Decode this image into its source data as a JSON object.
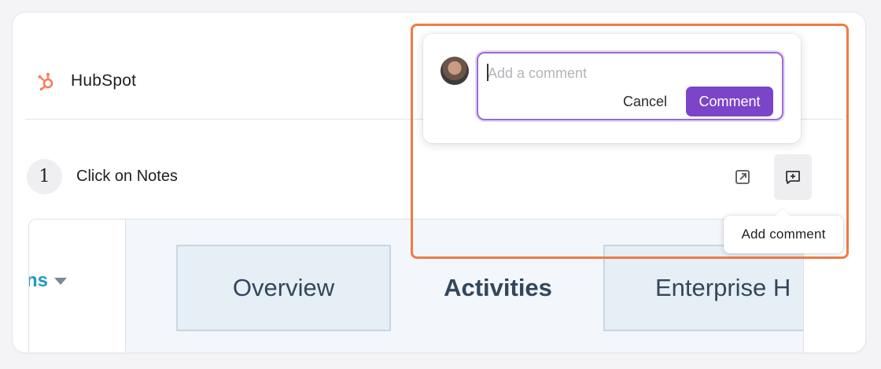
{
  "brand": {
    "name": "HubSpot",
    "logo_icon": "hubspot-sprocket-icon",
    "logo_color": "#ff7a59"
  },
  "step": {
    "number": "1",
    "text": "Click on Notes"
  },
  "actions": {
    "open_icon": "open-external-icon",
    "add_comment_icon": "add-comment-icon",
    "add_comment_tooltip": "Add comment"
  },
  "comment_popover": {
    "avatar_icon": "user-avatar",
    "placeholder": "Add a comment",
    "value": "",
    "cancel_label": "Cancel",
    "submit_label": "Comment",
    "accent_color": "#7b44c9"
  },
  "screenshot": {
    "left_label": "ns",
    "left_label_color": "#1e9bbc",
    "tabs": [
      {
        "label": "Overview"
      },
      {
        "label": "Activities"
      },
      {
        "label": "Enterprise H"
      }
    ]
  },
  "highlight_color": "#f07b45"
}
